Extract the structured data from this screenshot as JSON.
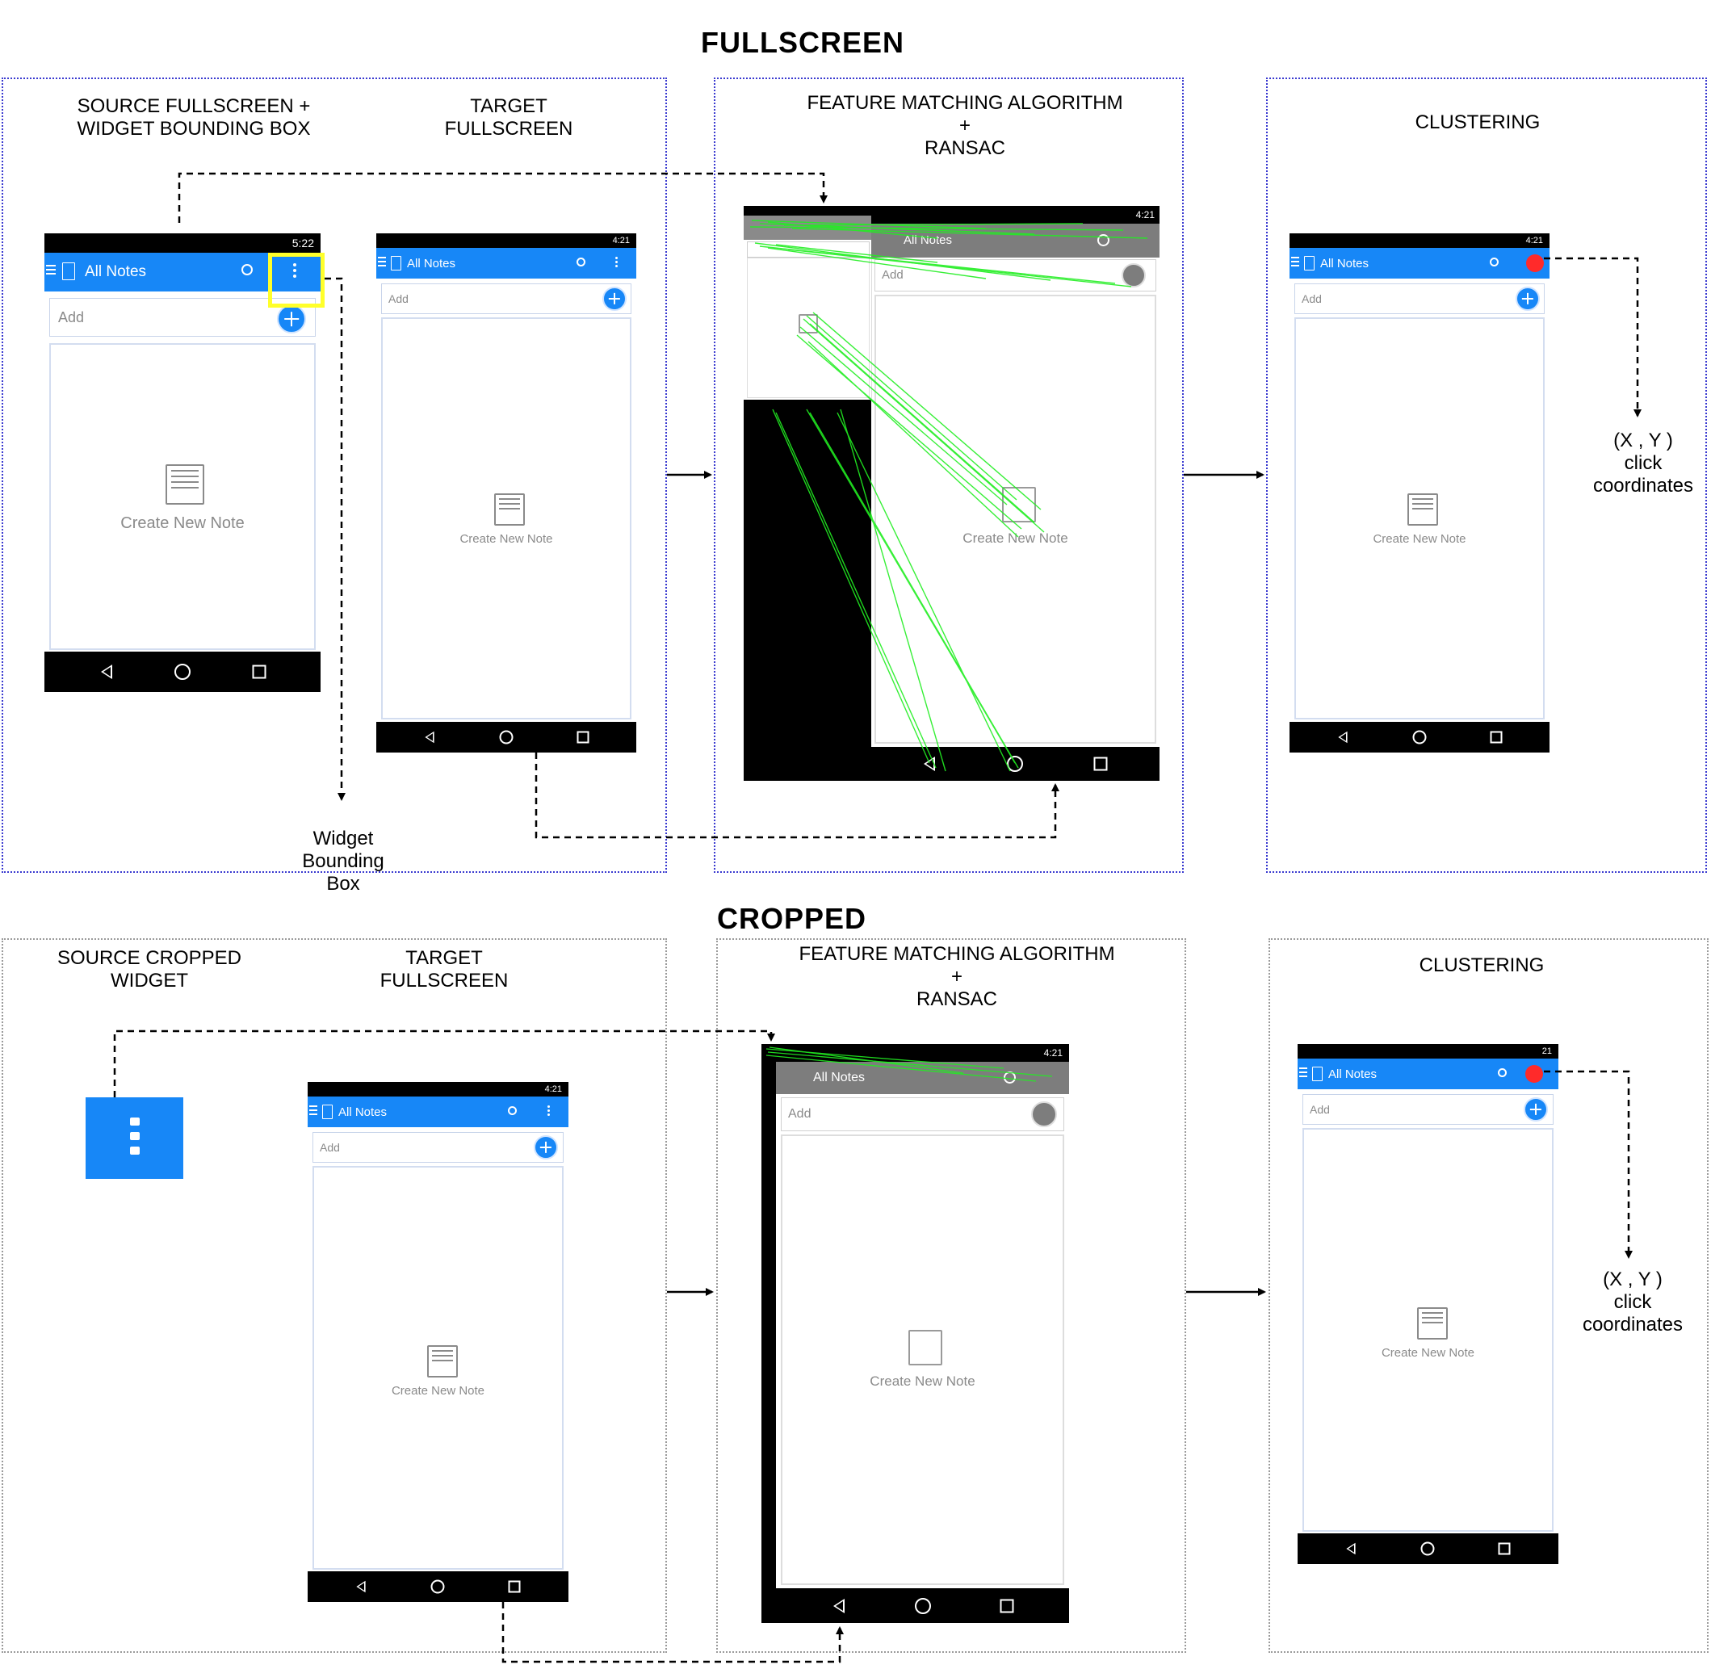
{
  "sections": {
    "fullscreen_title": "FULLSCREEN",
    "cropped_title": "CROPPED"
  },
  "fullscreen": {
    "source_label": "SOURCE FULLSCREEN +\nWIDGET  BOUNDING BOX",
    "target_label": "TARGET\nFULLSCREEN",
    "matching_label": "FEATURE MATCHING ALGORITHM\n+\nRANSAC",
    "clustering_label": "CLUSTERING",
    "bbox_label": "Widget\nBounding\nBox",
    "coords_label": "(X , Y )\nclick\ncoordinates"
  },
  "cropped": {
    "source_label": "SOURCE CROPPED\nWIDGET",
    "target_label": "TARGET\nFULLSCREEN",
    "matching_label": "FEATURE MATCHING ALGORITHM\n+\nRANSAC",
    "clustering_label": "CLUSTERING",
    "coords_label": "(X , Y )\nclick\ncoordinates"
  },
  "phone": {
    "app_title": "All Notes",
    "add_placeholder": "Add",
    "empty_text": "Create New Note",
    "time_source": "5:22",
    "time_target": "4:21",
    "time_cluster_cropped": "21"
  },
  "colors": {
    "app_blue": "#1787f7",
    "highlight_yellow": "#ffff2a",
    "click_red": "#ff2a2a",
    "match_green": "#22ee22"
  }
}
